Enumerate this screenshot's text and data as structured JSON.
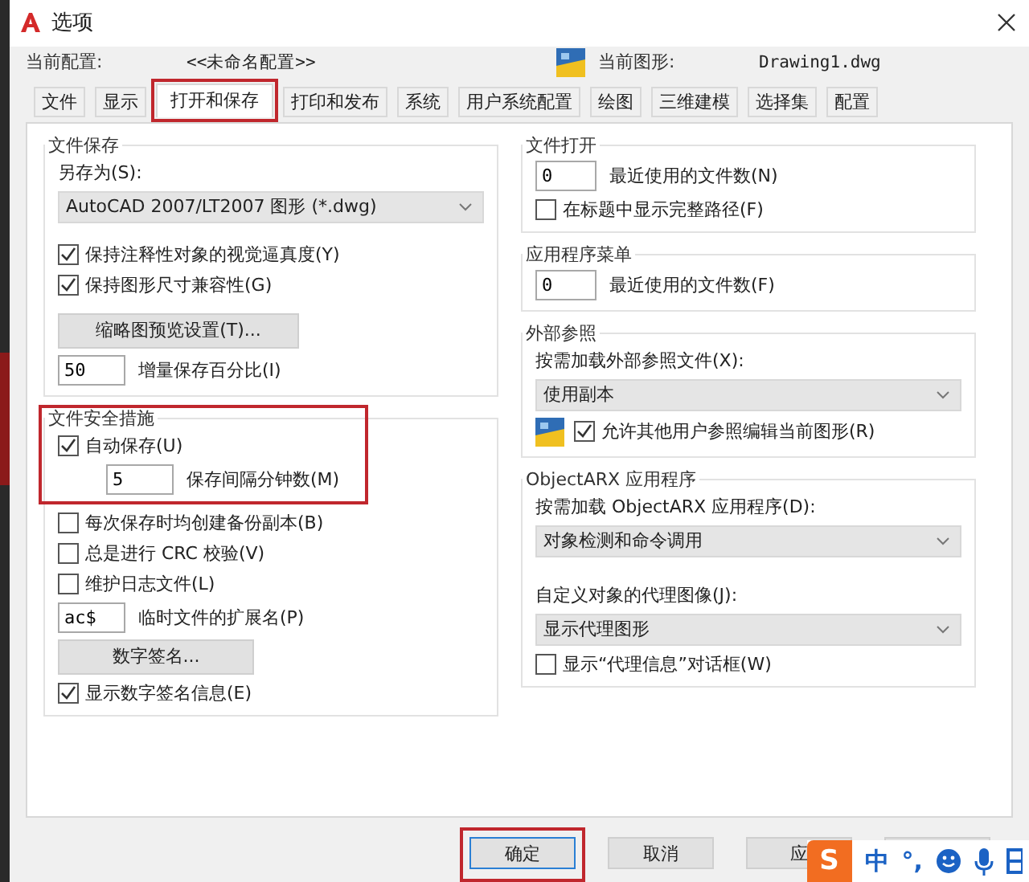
{
  "window": {
    "title": "选项"
  },
  "profile": {
    "label": "当前配置:",
    "value": "<<未命名配置>>"
  },
  "drawing": {
    "label": "当前图形:",
    "value": "Drawing1.dwg"
  },
  "tabs": [
    {
      "label": "文件",
      "selected": false,
      "highlighted": false
    },
    {
      "label": "显示",
      "selected": false,
      "highlighted": false
    },
    {
      "label": "打开和保存",
      "selected": true,
      "highlighted": true
    },
    {
      "label": "打印和发布",
      "selected": false,
      "highlighted": false
    },
    {
      "label": "系统",
      "selected": false,
      "highlighted": false
    },
    {
      "label": "用户系统配置",
      "selected": false,
      "highlighted": false
    },
    {
      "label": "绘图",
      "selected": false,
      "highlighted": false
    },
    {
      "label": "三维建模",
      "selected": false,
      "highlighted": false
    },
    {
      "label": "选择集",
      "selected": false,
      "highlighted": false
    },
    {
      "label": "配置",
      "selected": false,
      "highlighted": false
    }
  ],
  "file_save": {
    "title": "文件保存",
    "save_as_label": "另存为(S):",
    "save_as_value": "AutoCAD 2007/LT2007 图形 (*.dwg)",
    "checkboxes": [
      {
        "label": "保持注释性对象的视觉逼真度(Y)",
        "checked": true
      },
      {
        "label": "保持图形尺寸兼容性(G)",
        "checked": true
      }
    ],
    "thumbnail_button": "缩略图预览设置(T)...",
    "incremental": {
      "value": "50",
      "label": "增量保存百分比(I)"
    }
  },
  "file_safety": {
    "title": "文件安全措施",
    "highlighted": true,
    "autosave": {
      "label": "自动保存(U)",
      "checked": true
    },
    "interval": {
      "value": "5",
      "label": "保存间隔分钟数(M)"
    },
    "checkboxes": [
      {
        "label": "每次保存时均创建备份副本(B)",
        "checked": false
      },
      {
        "label": "总是进行 CRC 校验(V)",
        "checked": false
      },
      {
        "label": "维护日志文件(L)",
        "checked": false
      }
    ],
    "temp_ext": {
      "value": "ac$",
      "label": "临时文件的扩展名(P)"
    },
    "signature_button": "数字签名...",
    "show_signature": {
      "label": "显示数字签名信息(E)",
      "checked": true
    }
  },
  "file_open": {
    "title": "文件打开",
    "recent": {
      "value": "0",
      "label": "最近使用的文件数(N)"
    },
    "full_path": {
      "label": "在标题中显示完整路径(F)",
      "checked": false
    }
  },
  "app_menu": {
    "title": "应用程序菜单",
    "recent": {
      "value": "0",
      "label": "最近使用的文件数(F)"
    }
  },
  "xref": {
    "title": "外部参照",
    "demand_label": "按需加载外部参照文件(X):",
    "demand_value": "使用副本",
    "allow_edit": {
      "label": "允许其他用户参照编辑当前图形(R)",
      "checked": true
    }
  },
  "objectarx": {
    "title": "ObjectARX 应用程序",
    "demand_label": "按需加载 ObjectARX 应用程序(D):",
    "demand_value": "对象检测和命令调用",
    "proxy_label": "自定义对象的代理图像(J):",
    "proxy_value": "显示代理图形",
    "proxy_dialog": {
      "label": "显示“代理信息”对话框(W)",
      "checked": false
    }
  },
  "buttons": [
    {
      "label": "确定",
      "focused": true,
      "highlighted": true
    },
    {
      "label": "取消",
      "focused": false,
      "highlighted": false
    },
    {
      "label": "应",
      "focused": false,
      "highlighted": false
    },
    {
      "focused": false,
      "highlighted": false
    }
  ],
  "ime": {
    "logo": "S",
    "mode": "中",
    "punct": "°,"
  }
}
